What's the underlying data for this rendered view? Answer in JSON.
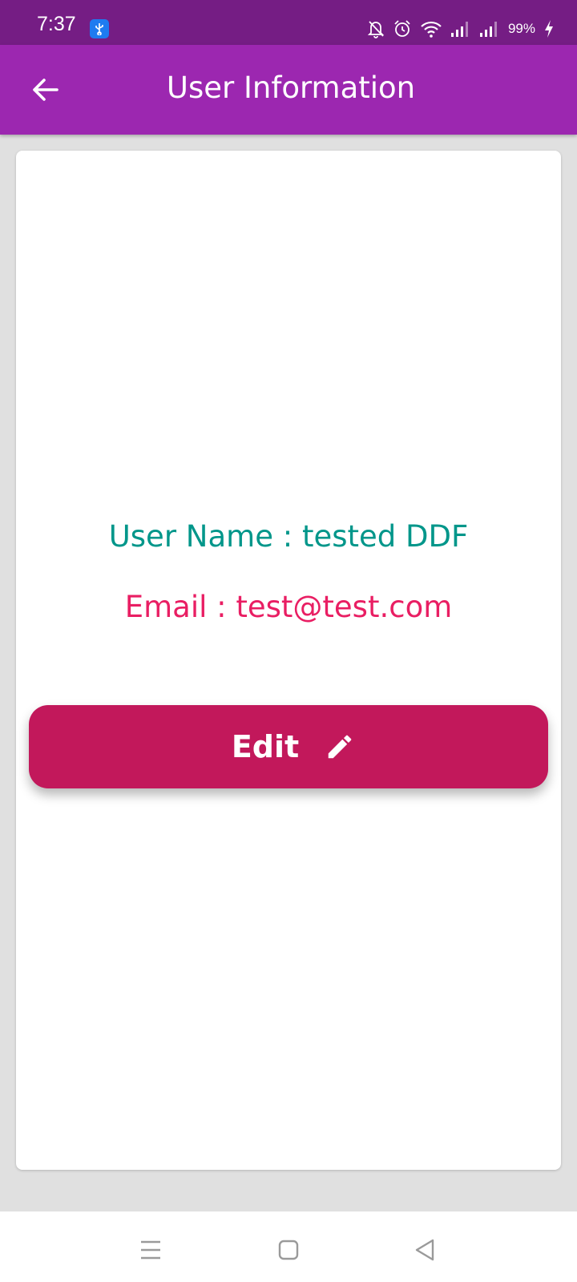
{
  "status_bar": {
    "time": "7:37",
    "battery": "99%",
    "icons": [
      "usb-icon",
      "silent-bell-icon",
      "alarm-icon",
      "wifi-icon",
      "signal-icon",
      "signal-icon",
      "charging-bolt-icon"
    ]
  },
  "app_bar": {
    "title": "User Information",
    "back_icon": "arrow-back-icon"
  },
  "profile": {
    "user_name": "User Name : tested DDF",
    "email": "Email : test@test.com"
  },
  "edit_button": {
    "label": "Edit",
    "icon": "pencil-icon"
  },
  "nav_bar": {
    "icons": [
      "menu-icon",
      "home-square-icon",
      "back-triangle-icon"
    ]
  },
  "colors": {
    "status_bar": "#751d84",
    "app_bar": "#9c27b0",
    "user_name": "#00968a",
    "email": "#e91e63",
    "edit_button": "#c2185b",
    "page_background": "#e0e0e0"
  }
}
